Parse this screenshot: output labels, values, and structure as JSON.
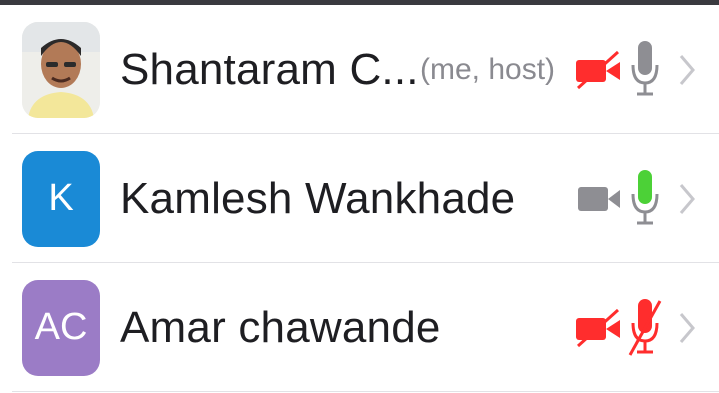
{
  "participants": [
    {
      "name": "Shantaram C...",
      "tag": "(me, host)",
      "avatar": {
        "type": "photo",
        "initials": "",
        "color": "#f0f0ec"
      },
      "video": "off",
      "audio": "muted-gray"
    },
    {
      "name": "Kamlesh Wankhade",
      "tag": "",
      "avatar": {
        "type": "initials",
        "initials": "K",
        "color": "#1a8ad6"
      },
      "video": "on",
      "audio": "active"
    },
    {
      "name": "Amar chawande",
      "tag": "",
      "avatar": {
        "type": "initials",
        "initials": "AC",
        "color": "#9b7cc6"
      },
      "video": "off",
      "audio": "muted"
    }
  ],
  "colors": {
    "video_off": "#ff2d2d",
    "video_on": "#8e8e93",
    "mic_active": "#4cd137",
    "mic_idle": "#8e8e93",
    "mic_muted": "#ff2d2d",
    "chevron": "#c7c7cc"
  }
}
